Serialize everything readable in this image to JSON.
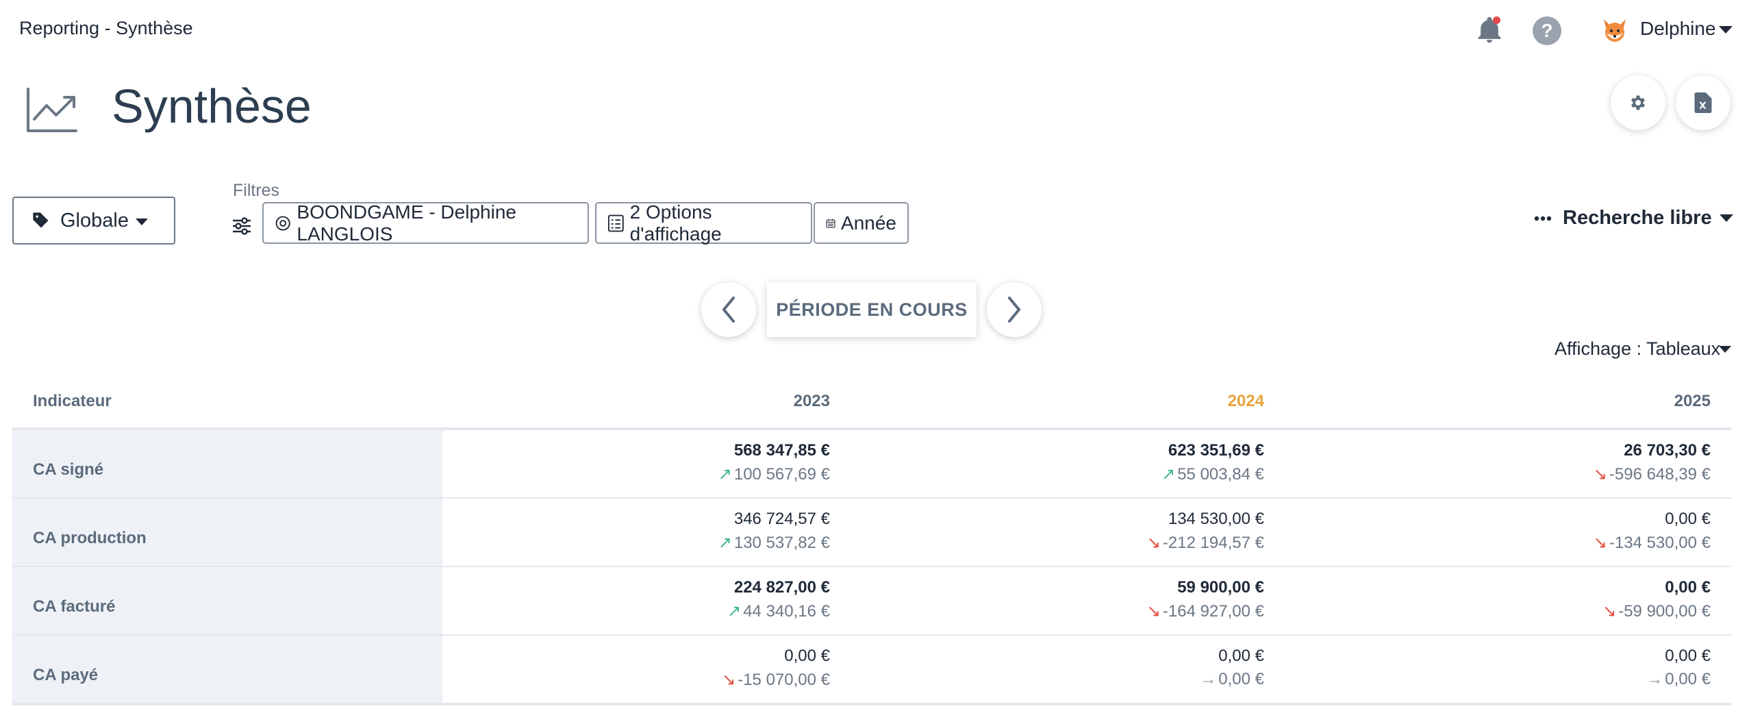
{
  "app": {
    "title": "Reporting - Synthèse"
  },
  "user": {
    "name": "Delphine",
    "help_label": "?"
  },
  "header": {
    "title": "Synthèse"
  },
  "filters": {
    "scope_label": "Globale",
    "label": "Filtres",
    "chips": [
      "BOONDGAME - Delphine LANGLOIS",
      "2 Options d'affichage",
      "Année"
    ],
    "free_search": "Recherche libre"
  },
  "period": {
    "label": "PÉRIODE EN COURS"
  },
  "display_mode": "Affichage : Tableaux",
  "colors": {
    "current_year": "#e8a33c",
    "up": "#3fb58a",
    "down": "#e24c3b",
    "label_bg": "#eef1f6"
  },
  "table": {
    "header": "Indicateur",
    "years": [
      "2023",
      "2024",
      "2025"
    ],
    "rows": [
      {
        "label": "CA signé",
        "bold": true,
        "cells": [
          {
            "value": "568 347,85 €",
            "delta": "100 567,69 €",
            "trend": "up"
          },
          {
            "value": "623 351,69 €",
            "delta": "55 003,84 €",
            "trend": "up"
          },
          {
            "value": "26 703,30 €",
            "delta": "-596 648,39 €",
            "trend": "down"
          }
        ]
      },
      {
        "label": "CA production",
        "bold": false,
        "cells": [
          {
            "value": "346 724,57 €",
            "delta": "130 537,82 €",
            "trend": "up"
          },
          {
            "value": "134 530,00 €",
            "delta": "-212 194,57 €",
            "trend": "down"
          },
          {
            "value": "0,00 €",
            "delta": "-134 530,00 €",
            "trend": "down"
          }
        ]
      },
      {
        "label": "CA facturé",
        "bold": true,
        "cells": [
          {
            "value": "224 827,00 €",
            "delta": "44 340,16 €",
            "trend": "up"
          },
          {
            "value": "59 900,00 €",
            "delta": "-164 927,00 €",
            "trend": "down"
          },
          {
            "value": "0,00 €",
            "delta": "-59 900,00 €",
            "trend": "down"
          }
        ]
      },
      {
        "label": "CA payé",
        "bold": false,
        "cells": [
          {
            "value": "0,00 €",
            "delta": "-15 070,00 €",
            "trend": "down"
          },
          {
            "value": "0,00 €",
            "delta": "0,00 €",
            "trend": "flat"
          },
          {
            "value": "0,00 €",
            "delta": "0,00 €",
            "trend": "flat"
          }
        ]
      }
    ]
  }
}
